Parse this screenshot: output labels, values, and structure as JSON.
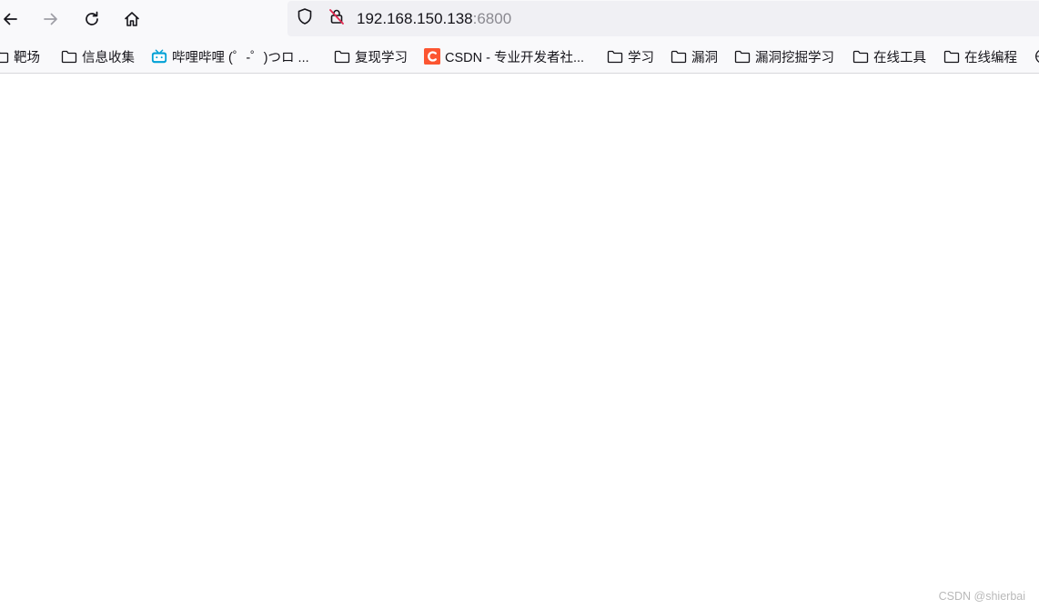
{
  "address_bar": {
    "host": "192.168.150.138",
    "port": ":6800"
  },
  "icons": {
    "back": "arrow-left-icon",
    "forward": "arrow-right-icon",
    "reload": "reload-icon",
    "home": "home-icon",
    "tracking_protection": "shield-icon",
    "insecure_connection": "insecure-lock-icon",
    "bookmark_folder": "folder-icon"
  },
  "bookmarks": [
    {
      "label": "靶场",
      "type": "folder"
    },
    {
      "label": "信息收集",
      "type": "folder"
    },
    {
      "label": "哔哩哔哩 (゜-゜)つロ ...",
      "type": "site",
      "icon": "bilibili-icon",
      "color": "#00a1d6"
    },
    {
      "label": "复现学习",
      "type": "folder"
    },
    {
      "label": "CSDN - 专业开发者社...",
      "type": "site",
      "icon": "csdn-icon",
      "color": "#fc5531"
    },
    {
      "label": "学习",
      "type": "folder"
    },
    {
      "label": "漏洞",
      "type": "folder"
    },
    {
      "label": "漏洞挖掘学习",
      "type": "folder"
    },
    {
      "label": "在线工具",
      "type": "folder"
    },
    {
      "label": "在线编程",
      "type": "folder"
    }
  ],
  "watermark": "CSDN @shierbai"
}
